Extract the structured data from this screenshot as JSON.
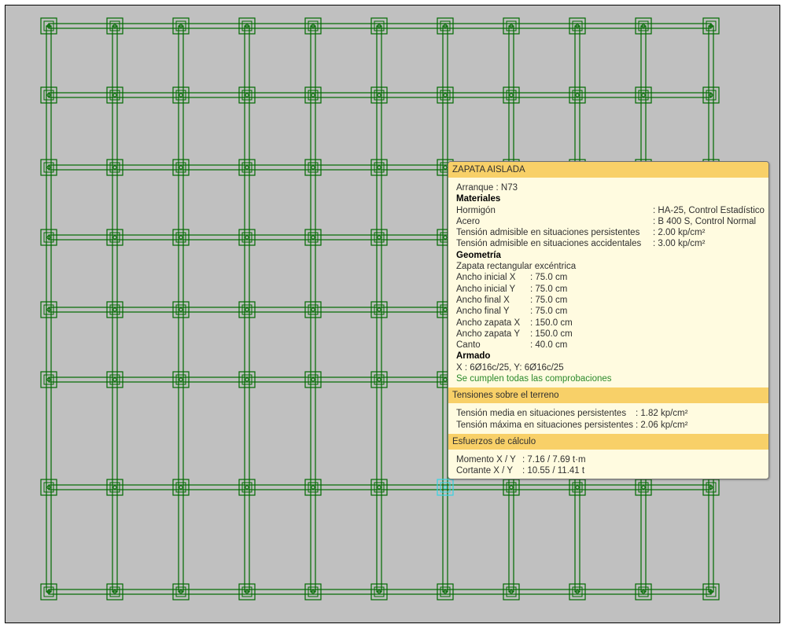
{
  "plan": {
    "footing_label": "Zapata aislada",
    "grid_columns": 11,
    "grid_rows": 8,
    "selected_node": "N73",
    "colors": {
      "background": "#c0c0c0",
      "beam": "#006a00",
      "selected": "#33d5e6"
    }
  },
  "tooltip": {
    "title": "ZAPATA AISLADA",
    "arranque": "Arranque : N73",
    "materiales": {
      "heading": "Materiales",
      "rows": [
        {
          "label": "Hormigón",
          "value": ": HA-25, Control Estadístico"
        },
        {
          "label": "Acero",
          "value": ": B 400 S, Control Normal"
        },
        {
          "label": "Tensión admisible en situaciones persistentes",
          "value": ": 2.00 kp/cm²"
        },
        {
          "label": "Tensión admisible en situaciones accidentales",
          "value": ": 3.00 kp/cm²"
        }
      ]
    },
    "geometria": {
      "heading": "Geometría",
      "type": "Zapata rectangular excéntrica",
      "rows": [
        {
          "label": "Ancho inicial X",
          "value": ": 75.0 cm"
        },
        {
          "label": "Ancho inicial Y",
          "value": ": 75.0 cm"
        },
        {
          "label": "Ancho final X",
          "value": ": 75.0 cm"
        },
        {
          "label": "Ancho final Y",
          "value": ": 75.0 cm"
        },
        {
          "label": "Ancho zapata X",
          "value": ": 150.0 cm"
        },
        {
          "label": "Ancho zapata Y",
          "value": ": 150.0 cm"
        },
        {
          "label": "Canto",
          "value": ": 40.0 cm"
        }
      ]
    },
    "armado": {
      "heading": "Armado",
      "value": "X : 6Ø16c/25, Y: 6Ø16c/25",
      "status": "Se cumplen todas las comprobaciones"
    },
    "tensiones": {
      "title": "Tensiones sobre el terreno",
      "rows": [
        {
          "label": "Tensión media en situaciones persistentes",
          "value": ": 1.82 kp/cm²"
        },
        {
          "label": "Tensión máxima en situaciones persistentes",
          "value": ": 2.06 kp/cm²"
        }
      ]
    },
    "esfuerzos": {
      "title": "Esfuerzos de cálculo",
      "rows": [
        {
          "label": "Momento X / Y",
          "value": ": 7.16 / 7.69 t·m"
        },
        {
          "label": "Cortante X / Y",
          "value": ": 10.55 / 11.41 t"
        }
      ]
    }
  }
}
